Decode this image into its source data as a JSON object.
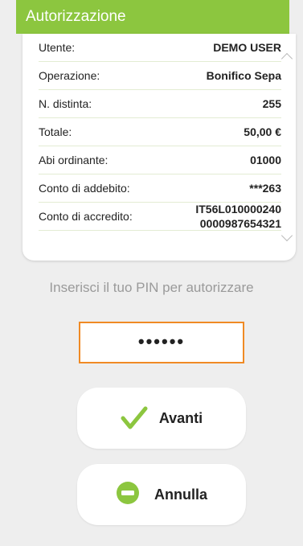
{
  "header": {
    "title": "Autorizzazione"
  },
  "details": [
    {
      "label": "Utente:",
      "value": "DEMO USER"
    },
    {
      "label": "Operazione:",
      "value": "Bonifico Sepa"
    },
    {
      "label": "N. distinta:",
      "value": "255"
    },
    {
      "label": "Totale:",
      "value": "50,00 €"
    },
    {
      "label": "Abi ordinante:",
      "value": "01000"
    },
    {
      "label": "Conto di addebito:",
      "value": "***263"
    },
    {
      "label": "Conto di accredito:",
      "value_line1": "IT56L010000240",
      "value_line2": "0000987654321"
    }
  ],
  "pin": {
    "prompt": "Inserisci il tuo PIN per autorizzare",
    "value": "••••••"
  },
  "buttons": {
    "next_label": "Avanti",
    "cancel_label": "Annulla"
  },
  "icons": {
    "next": "checkmark-icon",
    "cancel": "minus-circle-icon"
  },
  "colors": {
    "accent": "#8cc63f",
    "pin_border": "#f08a24"
  }
}
